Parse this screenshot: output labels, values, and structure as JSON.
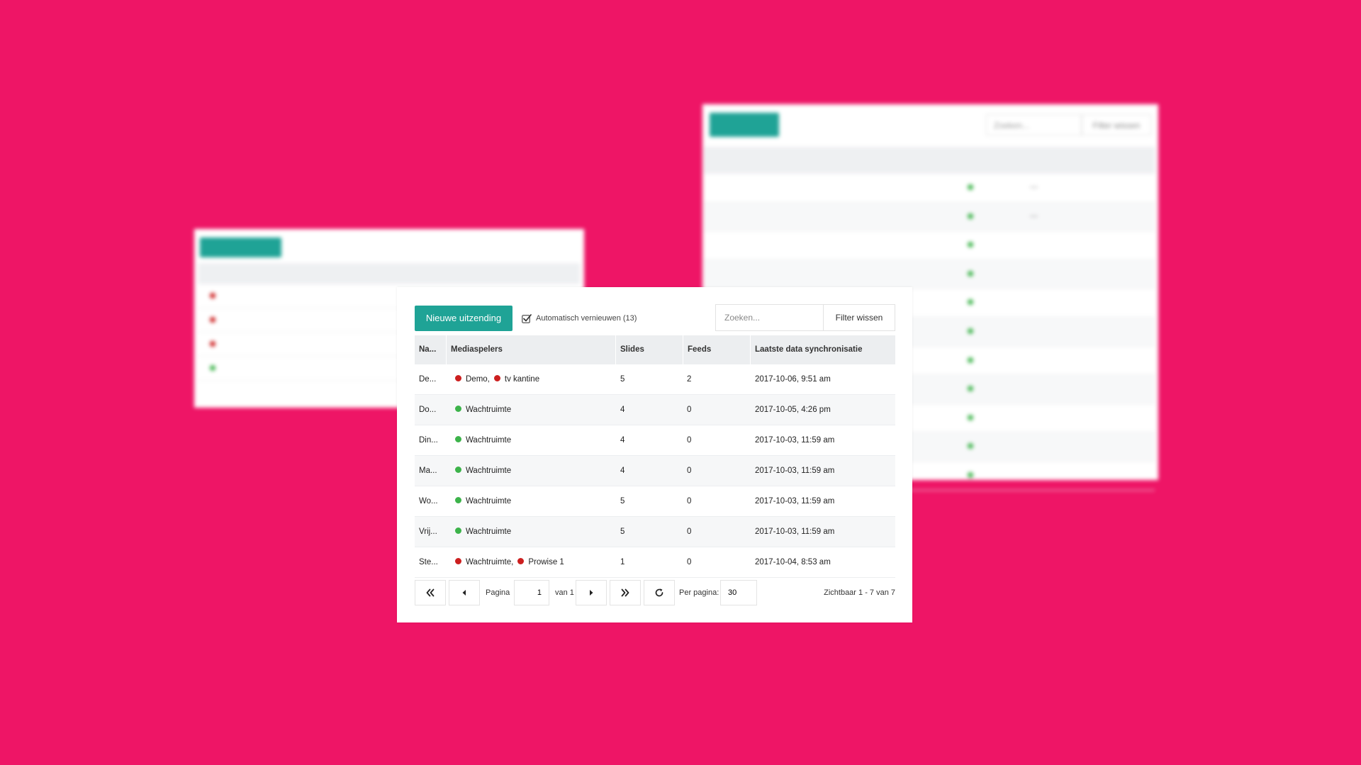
{
  "colors": {
    "background": "#ee1566",
    "accent": "#1fa396",
    "status_online": "#3cb34a",
    "status_offline": "#cc1f1f"
  },
  "back_right_panel": {
    "search_placeholder": "Zoeken...",
    "filter_clear_label": "Filter wissen",
    "rows": [
      {
        "status": "online",
        "sync": "—"
      },
      {
        "status": "online",
        "sync": "—"
      },
      {
        "status": "online",
        "sync": ""
      },
      {
        "status": "online",
        "sync": ""
      },
      {
        "status": "online",
        "sync": ""
      },
      {
        "status": "online",
        "sync": ""
      },
      {
        "status": "online",
        "sync": ""
      },
      {
        "status": "online",
        "sync": ""
      },
      {
        "status": "online",
        "sync": ""
      },
      {
        "status": "online",
        "sync": ""
      },
      {
        "status": "online",
        "sync": ""
      }
    ]
  },
  "back_left_panel": {
    "rows": [
      {
        "status": "offline"
      },
      {
        "status": "offline"
      },
      {
        "status": "offline"
      },
      {
        "status": "online"
      }
    ]
  },
  "toolbar": {
    "new_broadcast_label": "Nieuwe uitzending",
    "auto_refresh_label": "Automatisch vernieuwen (13)",
    "auto_refresh_checked": true,
    "search_placeholder": "Zoeken...",
    "filter_clear_label": "Filter wissen"
  },
  "table": {
    "columns": [
      {
        "key": "name",
        "label": "Na..."
      },
      {
        "key": "players",
        "label": "Mediaspelers"
      },
      {
        "key": "slides",
        "label": "Slides"
      },
      {
        "key": "feeds",
        "label": "Feeds"
      },
      {
        "key": "sync",
        "label": "Laatste data synchronisatie"
      }
    ],
    "rows": [
      {
        "name": "De...",
        "players": [
          {
            "label": "Demo,",
            "status": "offline"
          },
          {
            "label": "tv kantine",
            "status": "offline"
          }
        ],
        "slides": "5",
        "feeds": "2",
        "sync": "2017-10-06, 9:51 am"
      },
      {
        "name": "Do...",
        "players": [
          {
            "label": "Wachtruimte",
            "status": "online"
          }
        ],
        "slides": "4",
        "feeds": "0",
        "sync": "2017-10-05, 4:26 pm"
      },
      {
        "name": "Din...",
        "players": [
          {
            "label": "Wachtruimte",
            "status": "online"
          }
        ],
        "slides": "4",
        "feeds": "0",
        "sync": "2017-10-03, 11:59 am"
      },
      {
        "name": "Ma...",
        "players": [
          {
            "label": "Wachtruimte",
            "status": "online"
          }
        ],
        "slides": "4",
        "feeds": "0",
        "sync": "2017-10-03, 11:59 am"
      },
      {
        "name": "Wo...",
        "players": [
          {
            "label": "Wachtruimte",
            "status": "online"
          }
        ],
        "slides": "5",
        "feeds": "0",
        "sync": "2017-10-03, 11:59 am"
      },
      {
        "name": "Vrij...",
        "players": [
          {
            "label": "Wachtruimte",
            "status": "online"
          }
        ],
        "slides": "5",
        "feeds": "0",
        "sync": "2017-10-03, 11:59 am"
      },
      {
        "name": "Ste...",
        "players": [
          {
            "label": "Wachtruimte,",
            "status": "offline"
          },
          {
            "label": "Prowise 1",
            "status": "offline"
          }
        ],
        "slides": "1",
        "feeds": "0",
        "sync": "2017-10-04, 8:53 am"
      }
    ]
  },
  "pagination": {
    "page_label": "Pagina",
    "page_value": "1",
    "of_label": "van 1",
    "per_page_label": "Per pagina:",
    "per_page_value": "30",
    "visible_range": "Zichtbaar 1 - 7 van 7",
    "icons": {
      "first": "double-chevron-left-icon",
      "prev": "caret-left-icon",
      "next": "caret-right-icon",
      "last": "double-chevron-right-icon",
      "refresh": "refresh-icon"
    }
  }
}
